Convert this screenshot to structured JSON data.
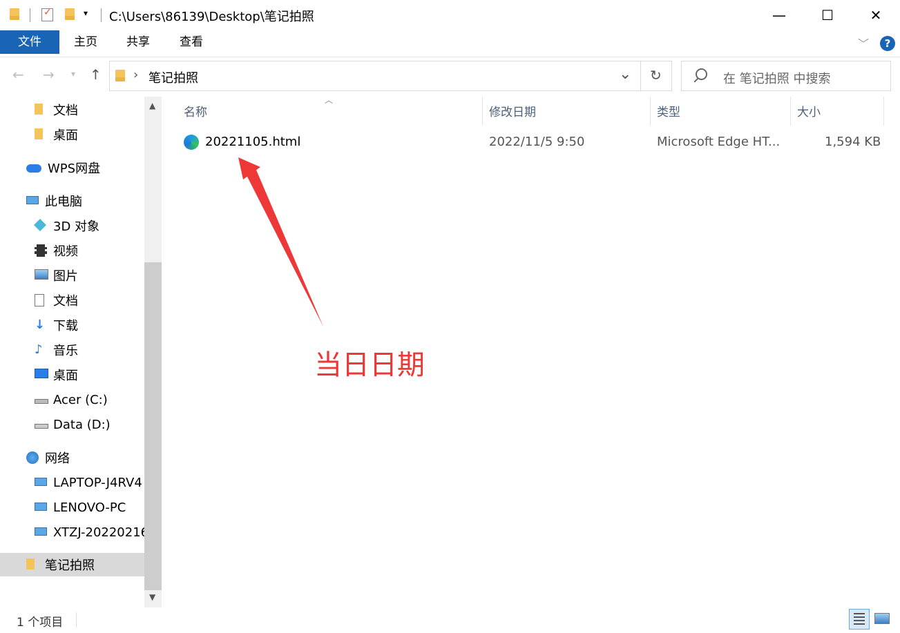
{
  "window": {
    "title": "C:\\Users\\86139\\Desktop\\笔记拍照",
    "controls": {
      "minimize": "—",
      "maximize": "☐",
      "close": "✕"
    }
  },
  "ribbon": {
    "tabs": [
      "文件",
      "主页",
      "共享",
      "查看"
    ],
    "help_icon": "?"
  },
  "address": {
    "breadcrumb_sep": "›",
    "location": "笔记拍照",
    "refresh_icon": "↻",
    "dropdown_icon": "⌄"
  },
  "search": {
    "placeholder": "在 笔记拍照 中搜索"
  },
  "sidebar": {
    "items": [
      {
        "label": "文档",
        "icon": "folder-icon"
      },
      {
        "label": "桌面",
        "icon": "folder-icon"
      },
      {
        "label": "WPS网盘",
        "icon": "cloud-icon"
      },
      {
        "label": "此电脑",
        "icon": "computer-icon"
      },
      {
        "label": "3D 对象",
        "icon": "cube-icon"
      },
      {
        "label": "视频",
        "icon": "film-icon"
      },
      {
        "label": "图片",
        "icon": "picture-icon"
      },
      {
        "label": "文档",
        "icon": "document-icon"
      },
      {
        "label": "下载",
        "icon": "download-icon"
      },
      {
        "label": "音乐",
        "icon": "music-icon"
      },
      {
        "label": "桌面",
        "icon": "desktop-icon"
      },
      {
        "label": "Acer (C:)",
        "icon": "drive-icon"
      },
      {
        "label": "Data (D:)",
        "icon": "drive-icon"
      },
      {
        "label": "网络",
        "icon": "network-icon"
      },
      {
        "label": "LAPTOP-J4RV4",
        "icon": "network-pc-icon"
      },
      {
        "label": "LENOVO-PC",
        "icon": "network-pc-icon"
      },
      {
        "label": "XTZJ-20220216",
        "icon": "network-pc-icon"
      },
      {
        "label": "笔记拍照",
        "icon": "folder-icon"
      }
    ]
  },
  "columns": {
    "name": "名称",
    "modified": "修改日期",
    "type": "类型",
    "size": "大小"
  },
  "files": [
    {
      "name": "20221105.html",
      "modified": "2022/11/5 9:50",
      "type": "Microsoft Edge HT...",
      "size": "1,594 KB",
      "icon": "edge-icon"
    }
  ],
  "annotation": {
    "text": "当日日期",
    "color": "#ee3838"
  },
  "status": {
    "count": "1 个项目"
  },
  "colors": {
    "accent": "#1a64b5",
    "selected": "#d9d9d9",
    "folder": "#f3c45a"
  }
}
